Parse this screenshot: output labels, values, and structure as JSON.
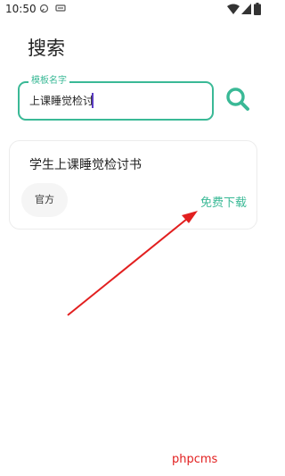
{
  "status_bar": {
    "time": "10:50"
  },
  "page": {
    "title": "搜索"
  },
  "search": {
    "label": "模板名字",
    "value": "上课睡觉检讨"
  },
  "result": {
    "title": "学生上课睡觉检讨书",
    "tag": "官方",
    "action": "免费下载"
  },
  "colors": {
    "accent": "#3ab996",
    "annotation": "#e21f1f"
  },
  "watermark": "phpcms"
}
